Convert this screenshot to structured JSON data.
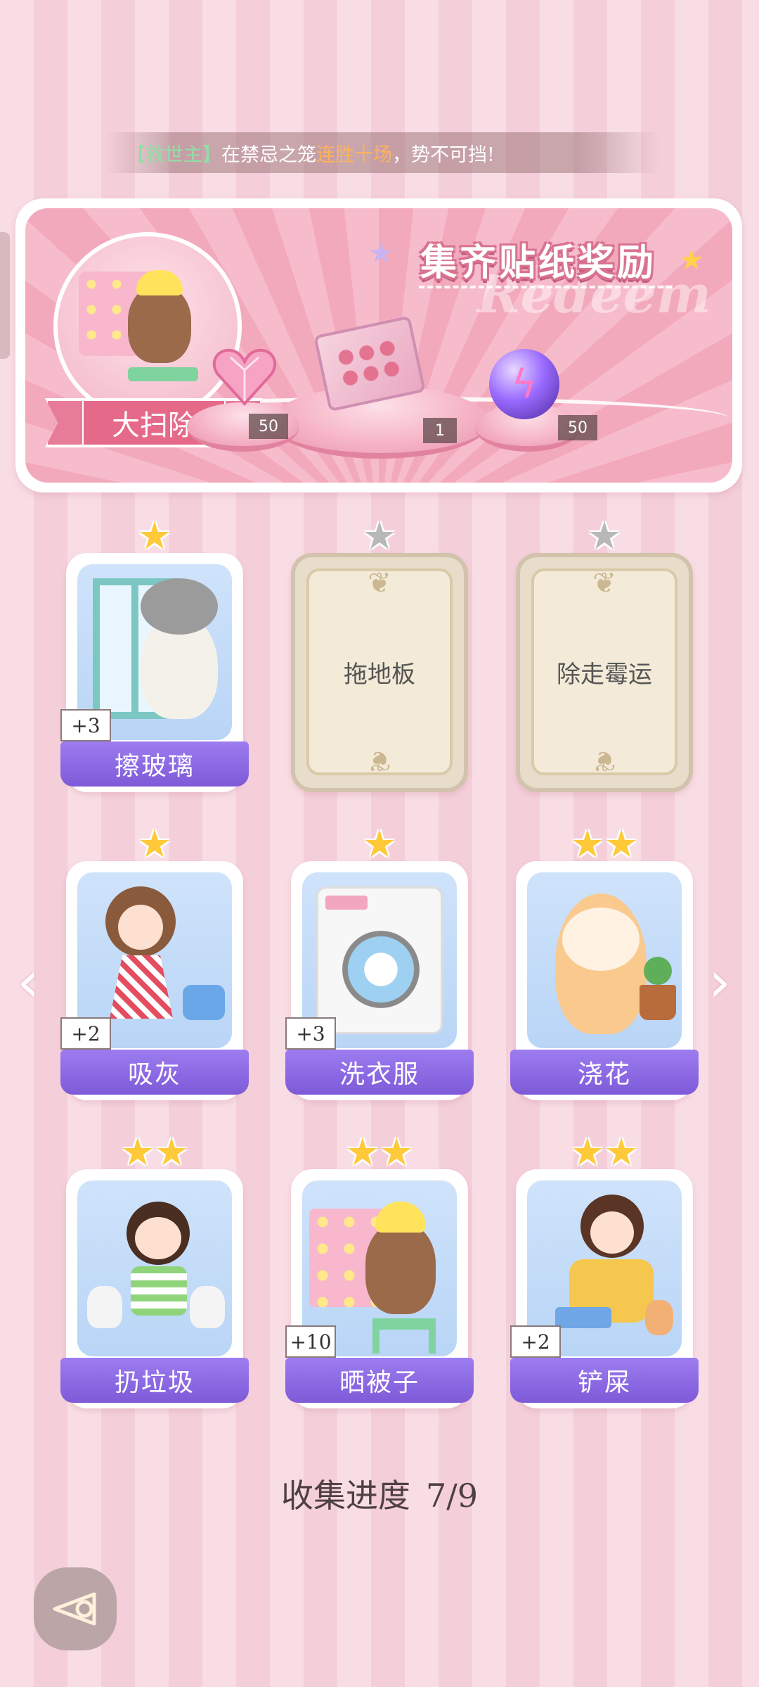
{
  "ticker": {
    "bracket_open": "【",
    "player_name": "救世主",
    "bracket_close": "】",
    "text_before": "在禁忌之笼",
    "highlight": "连胜十场",
    "text_after": "，势不可挡!"
  },
  "banner": {
    "title": "集齐贴纸奖励",
    "watermark": "Redeem",
    "event_name": "大扫除",
    "rewards": [
      {
        "icon": "heart-gem-icon",
        "count": "50"
      },
      {
        "icon": "gift-box-icon",
        "count": "1"
      },
      {
        "icon": "lightning-orb-icon",
        "count": "50"
      }
    ]
  },
  "cards": [
    {
      "label": "擦玻璃",
      "stars": 1,
      "collected": true,
      "bonus": "+3"
    },
    {
      "label": "拖地板",
      "stars": 1,
      "collected": false,
      "bonus": ""
    },
    {
      "label": "除走霉运",
      "stars": 1,
      "collected": false,
      "bonus": ""
    },
    {
      "label": "吸灰",
      "stars": 1,
      "collected": true,
      "bonus": "+2"
    },
    {
      "label": "洗衣服",
      "stars": 1,
      "collected": true,
      "bonus": "+3"
    },
    {
      "label": "浇花",
      "stars": 2,
      "collected": true,
      "bonus": ""
    },
    {
      "label": "扔垃圾",
      "stars": 2,
      "collected": true,
      "bonus": ""
    },
    {
      "label": "晒被子",
      "stars": 2,
      "collected": true,
      "bonus": "+10"
    },
    {
      "label": "铲屎",
      "stars": 2,
      "collected": true,
      "bonus": "+2"
    }
  ],
  "progress": {
    "label": "收集进度",
    "value": "7/9"
  },
  "icons": {
    "star": "star-icon",
    "prev": "chevron-left-icon",
    "next": "chevron-right-icon",
    "back": "back-icon"
  },
  "colors": {
    "accent_purple": "#8a68e0",
    "pink": "#f3a9bc",
    "star_gold": "#ffc93a",
    "star_grey": "#b8b8b8"
  }
}
